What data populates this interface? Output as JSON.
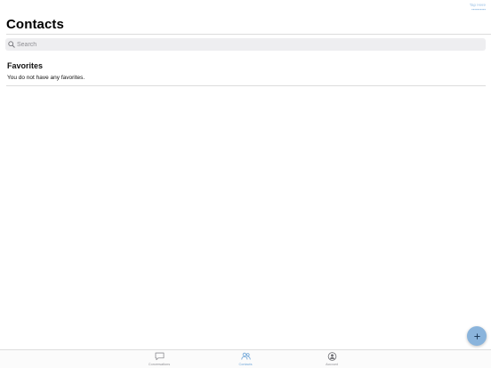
{
  "status": {
    "line1": "Tap Here",
    "line2": "▪▪▪▪▪▪▪▪▪▪"
  },
  "header": {
    "title": "Contacts"
  },
  "search": {
    "placeholder": "Search"
  },
  "favorites": {
    "title": "Favorites",
    "empty_message": "You do not have any favorites."
  },
  "fab": {
    "icon": "plus-icon"
  },
  "tabs": [
    {
      "label": "Conversations",
      "icon": "chat-bubble-icon",
      "active": false
    },
    {
      "label": "Contacts",
      "icon": "people-icon",
      "active": true
    },
    {
      "label": "Account",
      "icon": "person-circle-icon",
      "active": false
    }
  ],
  "colors": {
    "accent": "#6fa6d8",
    "fab": "#8ab4dc",
    "inactive": "#8e8e93",
    "search_bg": "#eeeef0"
  }
}
